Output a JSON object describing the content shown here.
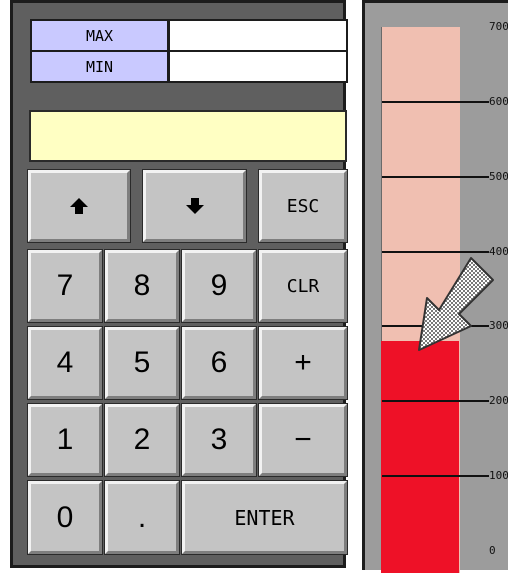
{
  "keypad": {
    "max_label": "MAX",
    "min_label": "MIN",
    "max_value": "",
    "min_value": "",
    "display_value": "",
    "keys": {
      "up": "up-arrow-icon",
      "down": "down-arrow-icon",
      "esc": "ESC",
      "k7": "7",
      "k8": "8",
      "k9": "9",
      "clr": "CLR",
      "k4": "4",
      "k5": "5",
      "k6": "6",
      "plus": "+",
      "k1": "1",
      "k2": "2",
      "k3": "3",
      "minus": "−",
      "k0": "0",
      "dot": ".",
      "enter": "ENTER"
    }
  },
  "gauge": {
    "ticks": [
      "700",
      "600",
      "500",
      "400",
      "300",
      "200",
      "100",
      "0"
    ],
    "range": [
      0,
      700
    ],
    "value": 280,
    "colors": {
      "fill": "#ee1127",
      "background": "#f0bfb1",
      "panel": "#9c9c9c"
    },
    "pointer_icon": "diagonal-arrow-icon"
  }
}
